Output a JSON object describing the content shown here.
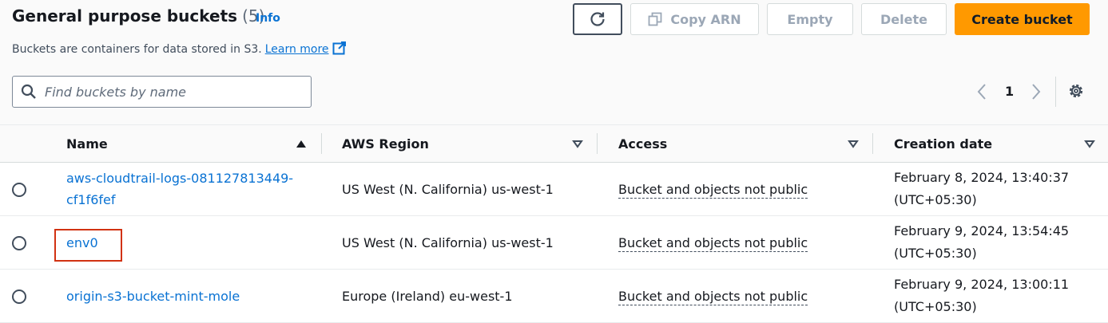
{
  "header": {
    "title": "General purpose buckets",
    "count": "(5)",
    "info": "Info",
    "description": "Buckets are containers for data stored in S3.",
    "learn_more": "Learn more"
  },
  "actions": {
    "copy_arn": "Copy ARN",
    "empty": "Empty",
    "delete": "Delete",
    "create_bucket": "Create bucket"
  },
  "search": {
    "placeholder": "Find buckets by name",
    "value": ""
  },
  "pagination": {
    "current_page": "1"
  },
  "table": {
    "columns": [
      "Name",
      "AWS Region",
      "Access",
      "Creation date"
    ],
    "rows": [
      {
        "name": "aws-cloudtrail-logs-081127813449-cf1f6fef",
        "region": "US West (N. California) us-west-1",
        "access": "Bucket and objects not public",
        "date": "February 8, 2024, 13:40:37 (UTC+05:30)"
      },
      {
        "name": "env0",
        "region": "US West (N. California) us-west-1",
        "access": "Bucket and objects not public",
        "date": "February 9, 2024, 13:54:45 (UTC+05:30)"
      },
      {
        "name": "origin-s3-bucket-mint-mole",
        "region": "Europe (Ireland) eu-west-1",
        "access": "Bucket and objects not public",
        "date": "February 9, 2024, 13:00:11 (UTC+05:30)"
      }
    ]
  },
  "colors": {
    "link": "#0972d3",
    "primary_button": "#ff9900",
    "highlight_box": "#d13212"
  }
}
